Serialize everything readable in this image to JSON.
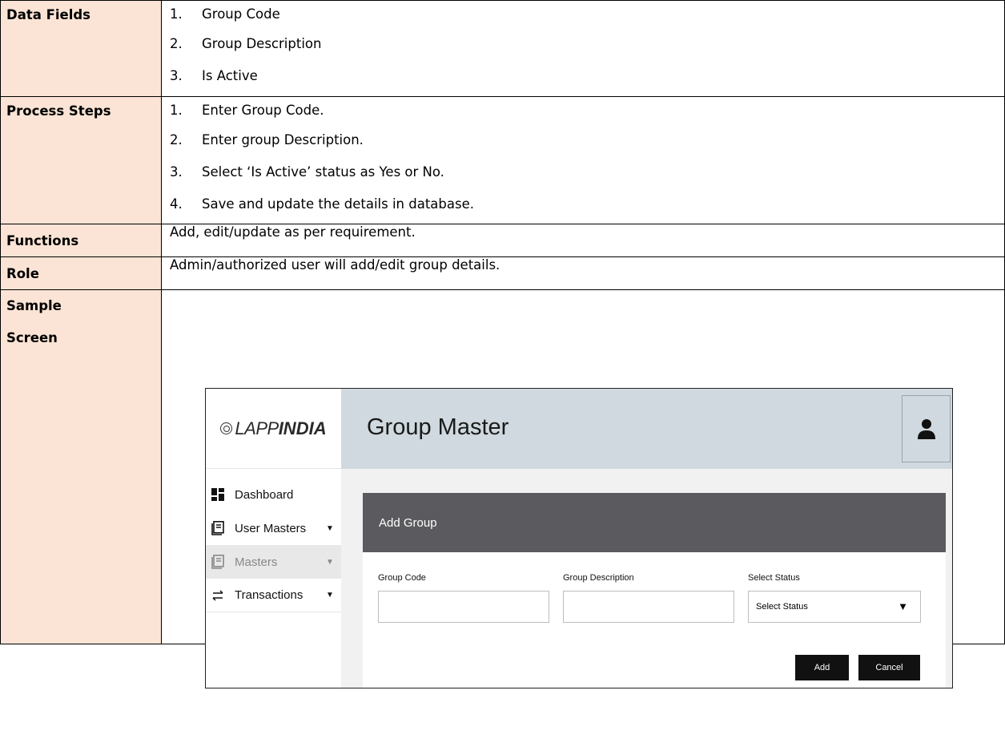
{
  "rows": {
    "data_fields": {
      "label": "Data Fields",
      "items": [
        {
          "num": "1.",
          "text": "Group Code"
        },
        {
          "num": "2.",
          "text": "Group Description"
        },
        {
          "num": "3.",
          "text": "Is Active"
        }
      ]
    },
    "process_steps": {
      "label": "Process Steps",
      "items": [
        {
          "num": "1.",
          "text": "Enter Group Code."
        },
        {
          "num": "2.",
          "text": "Enter group Description."
        },
        {
          "num": "3.",
          "text": "Select ‘Is Active’ status as Yes or No."
        },
        {
          "num": "4.",
          "text": "Save and update the details in database."
        }
      ]
    },
    "functions": {
      "label": "Functions",
      "text": "Add, edit/update as per requirement."
    },
    "role": {
      "label": "Role",
      "text": "Admin/authorized user will add/edit group details."
    },
    "sample": {
      "label_line1": "Sample",
      "label_line2": "Screen"
    }
  },
  "mockup": {
    "logo": {
      "part1": "LAPP",
      "part2": "INDIA"
    },
    "title": "Group Master",
    "sidebar": [
      {
        "label": "Dashboard",
        "icon": "dashboard-icon",
        "caret": ""
      },
      {
        "label": "User Masters",
        "icon": "book-icon",
        "caret": "▼"
      },
      {
        "label": "Masters",
        "icon": "book-icon",
        "caret": "▼"
      },
      {
        "label": "Transactions",
        "icon": "transfer-icon",
        "caret": "▼"
      }
    ],
    "panel_title": "Add Group",
    "fields": {
      "group_code_label": "Group Code",
      "group_description_label": "Group Description",
      "select_status_label": "Select Status",
      "select_status_value": "Select Status"
    },
    "buttons": {
      "add": "Add",
      "cancel": "Cancel"
    },
    "colors": {
      "header_bg": "#cfd9df",
      "panel_header_bg": "#5b5a5e",
      "label_bg": "#fbe4d5"
    }
  }
}
